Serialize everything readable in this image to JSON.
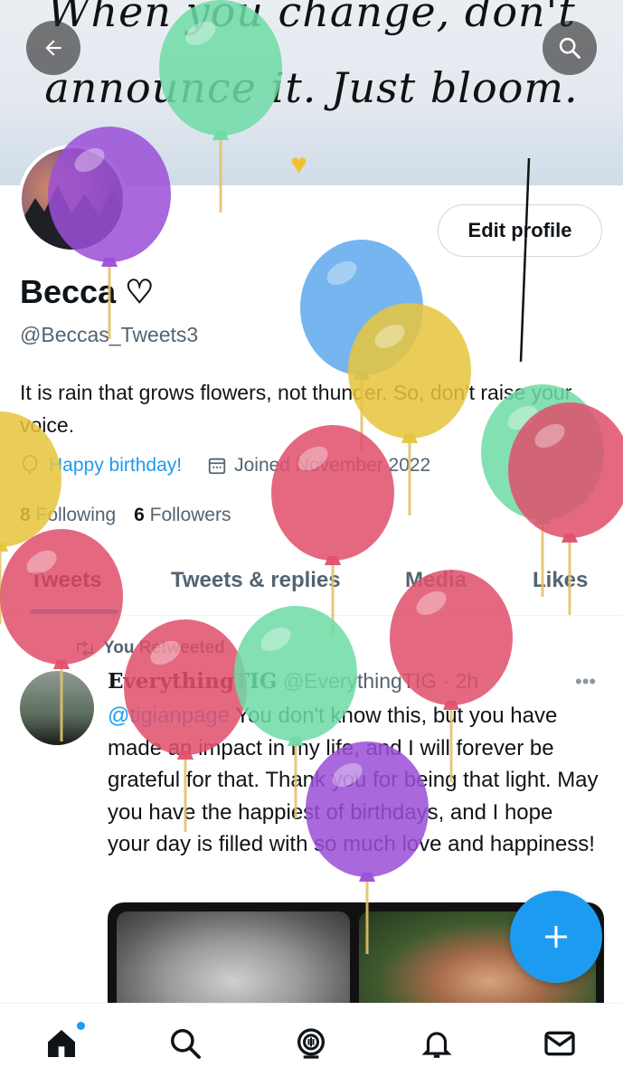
{
  "banner": {
    "quote_line1": "When you change, don't",
    "quote_line2": "announce it. Just bloom."
  },
  "header": {
    "back_icon": "arrow-left-icon",
    "search_icon": "search-icon"
  },
  "profile": {
    "edit_button": "Edit profile",
    "name": "Becca ♡",
    "handle": "@Beccas_Tweets3",
    "bio": "It is rain that grows flowers, not thunder. So, don't raise your voice.",
    "birthday": "Happy birthday!",
    "joined": "Joined November 2022",
    "following_count": "8",
    "following_label": "Following",
    "followers_count": "6",
    "followers_label": "Followers"
  },
  "tabs": [
    "Tweets",
    "Tweets & replies",
    "Media",
    "Likes"
  ],
  "tweet": {
    "retweet_label": "You Retweeted",
    "author": "EverythingTIG",
    "handle": "@EverythingTIG",
    "time": "· 2h",
    "mention": "@tigianpage",
    "text": " You don't know this, but you have made an impact in my life, and I will forever be grateful for that. Thank you for being that light. May you have the happiest of birthdays, and I hope your day is filled with so much love and happiness!"
  },
  "fab": {
    "icon": "plus-icon"
  },
  "bottom_nav": [
    "home-icon",
    "search-icon",
    "spaces-icon",
    "notifications-icon",
    "messages-icon"
  ],
  "colors": {
    "accent": "#1d9bf0",
    "text": "#0f1419",
    "secondary": "#536471"
  }
}
